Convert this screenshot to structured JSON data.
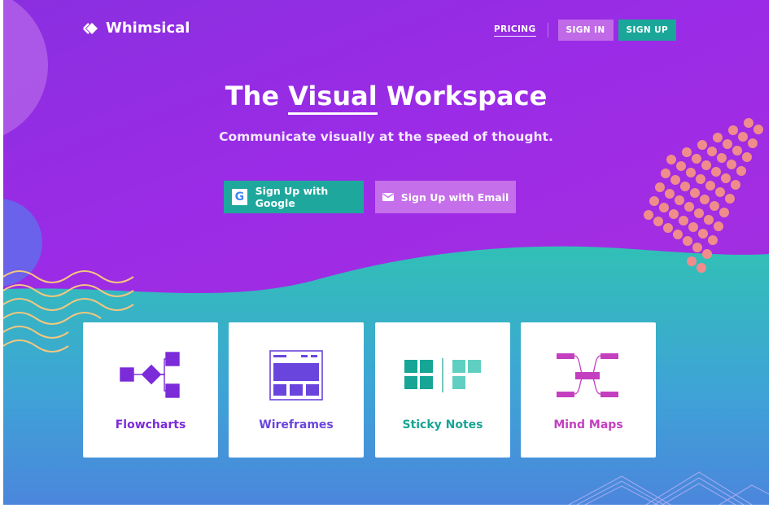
{
  "brand": {
    "name": "Whimsical",
    "logo_icon": "diamond-logo-icon"
  },
  "nav": {
    "pricing": "PRICING",
    "sign_in": "SIGN IN",
    "sign_up": "SIGN UP"
  },
  "hero": {
    "title_pre": "The",
    "title_emph": "Visual",
    "title_post": "Workspace",
    "subtitle": "Communicate visually at the speed of thought."
  },
  "cta": {
    "google_letter": "G",
    "google_label": "Sign Up with Google",
    "email_label": "Sign Up with Email"
  },
  "products": [
    {
      "label": "Flowcharts",
      "color": "#7b2bd8",
      "icon": "flowchart-icon"
    },
    {
      "label": "Wireframes",
      "color": "#6a45dd",
      "icon": "wireframe-icon"
    },
    {
      "label": "Sticky Notes",
      "color": "#17a596",
      "icon": "sticky-notes-icon"
    },
    {
      "label": "Mind Maps",
      "color": "#c43fc0",
      "icon": "mind-map-icon"
    }
  ],
  "colors": {
    "purple": "#9b2be6",
    "teal": "#1aa79a",
    "lavender": "#c06ae8",
    "coral": "#f08c8c",
    "wave_yellow": "#f4c77e"
  }
}
